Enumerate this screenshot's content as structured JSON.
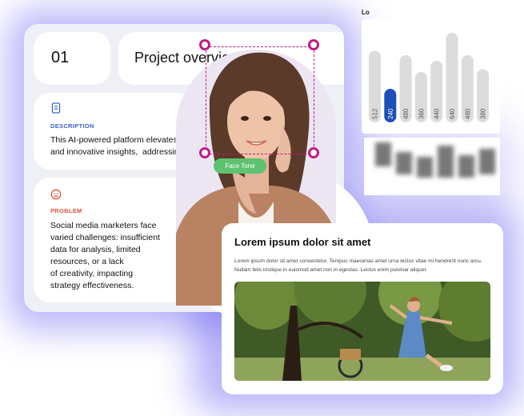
{
  "project": {
    "number": "01",
    "title": "Project overview",
    "description": {
      "label": "DESCRIPTION",
      "text": "This AI-powered platform elevates S\nand innovative insights,  addressing",
      "icon": "document-icon",
      "color": "#3a62c8"
    },
    "problem": {
      "label": "PROBLEM",
      "text": "Social media marketers face\nvaried challenges: insufficient\ndata for analysis, limited\nresources, or a lack\nof creativity, impacting\nstrategy effectiveness.",
      "icon": "sad-face-icon",
      "color": "#e2553b"
    }
  },
  "face_detection": {
    "tag": "Face Tone",
    "selection_color": "#c21a86",
    "tag_color": "#5ec270"
  },
  "bar_card": {
    "title": "Lo",
    "active_color": "#1d4fb8",
    "inactive_color": "#dcdcdc"
  },
  "chart_data": {
    "type": "bar",
    "categories": [
      "512",
      "240",
      "480",
      "360",
      "440",
      "640",
      "480",
      "380"
    ],
    "values": [
      512,
      240,
      480,
      360,
      440,
      640,
      480,
      380
    ],
    "highlighted_index": 1,
    "title": "",
    "xlabel": "",
    "ylabel": ""
  },
  "article": {
    "title": "Lorem ipsum dolor sit amet",
    "body": "Lorem ipsum dolor sit amet consectetur. Tempus maecenas amet urna lectus vitae mi hendrerit nunc arcu. Nullam felis tristique in euismod amet non in egestas. Lectus enim pulvinar aliquet."
  },
  "colors": {
    "glow": "#635af0",
    "card_bg": "#eef0f6"
  }
}
